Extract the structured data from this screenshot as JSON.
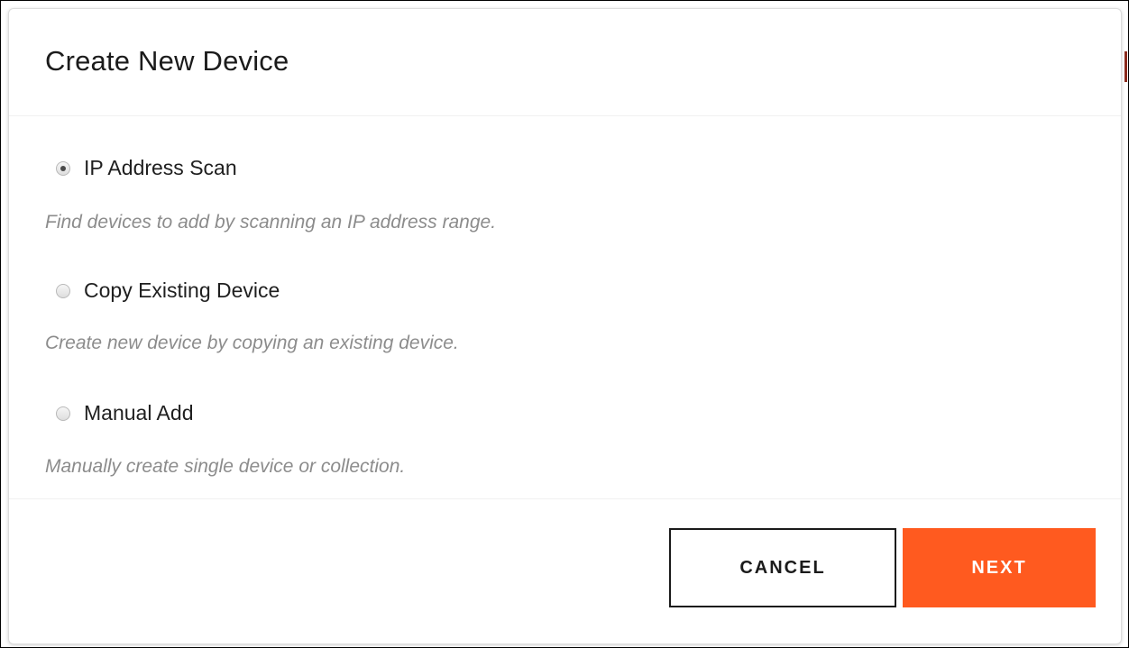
{
  "dialog": {
    "title": "Create New Device"
  },
  "options": [
    {
      "label": "IP Address Scan",
      "description": "Find devices to add by scanning an IP address range.",
      "selected": true
    },
    {
      "label": "Copy Existing Device",
      "description": "Create new device by copying an existing device.",
      "selected": false
    },
    {
      "label": "Manual Add",
      "description": "Manually create single device or collection.",
      "selected": false
    }
  ],
  "footer": {
    "cancel_label": "CANCEL",
    "next_label": "NEXT"
  },
  "colors": {
    "accent": "#ff5a1f",
    "title_text": "#1b1b1b",
    "description_text": "#8c8c8c"
  },
  "icons": {
    "radio_selected": "radio-selected-icon",
    "radio_unselected": "radio-unselected-icon"
  }
}
